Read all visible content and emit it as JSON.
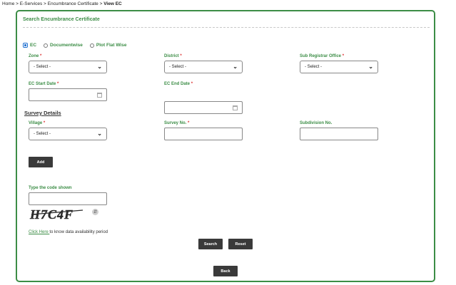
{
  "breadcrumb": {
    "home": "Home",
    "sep1": " > ",
    "eservices": "E-Services",
    "sep2": " > ",
    "ec": "Encumbrance Certificate",
    "sep3": " > ",
    "current": "View EC"
  },
  "panel": {
    "title": "Search Encumbrance Certificate"
  },
  "search_type": {
    "options": [
      "EC",
      "Documentwise",
      "Plot Flat Wise"
    ],
    "selected": "EC"
  },
  "fields": {
    "zone": {
      "label": "Zone",
      "value": "- Select -"
    },
    "district": {
      "label": "District",
      "value": "- Select -"
    },
    "sro": {
      "label": "Sub Registrar Office",
      "value": "- Select -"
    },
    "ec_start": {
      "label": "EC Start Date",
      "value": ""
    },
    "ec_end": {
      "label": "EC End Date",
      "value": ""
    }
  },
  "required_mark": "*",
  "survey": {
    "title": "Survey Details",
    "village": {
      "label": "Village",
      "value": "- Select -"
    },
    "survey_no": {
      "label": "Survey No.",
      "value": ""
    },
    "subdivision": {
      "label": "Subdivision No.",
      "value": ""
    },
    "add_label": "Add"
  },
  "captcha": {
    "label": "Type the code shown",
    "value": "",
    "code": "H7C4F"
  },
  "availability": {
    "link_text": "Click Here ",
    "text": "to know data availability period"
  },
  "buttons": {
    "search": "Search",
    "reset": "Reset",
    "back": "Back"
  },
  "colors": {
    "accent": "#3c8d46",
    "button": "#3a3a3a",
    "required": "#dd3333"
  }
}
